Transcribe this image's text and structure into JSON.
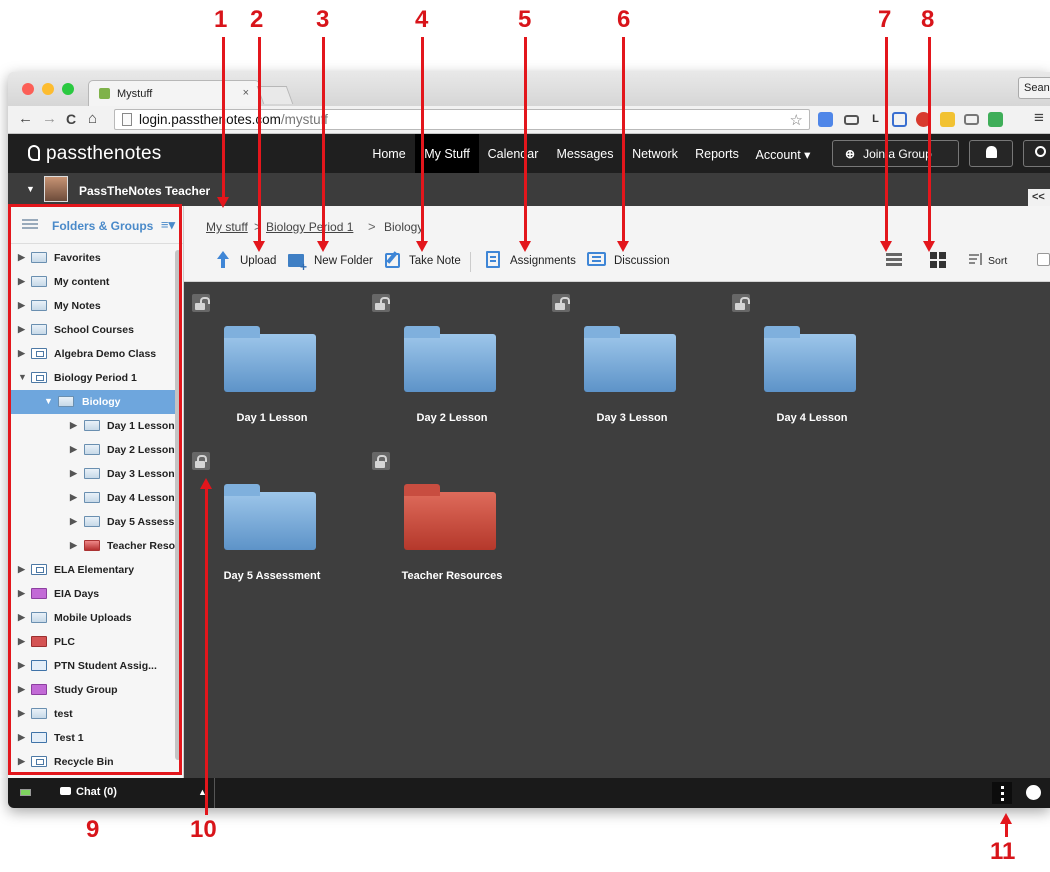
{
  "annotations": [
    "1",
    "2",
    "3",
    "4",
    "5",
    "6",
    "7",
    "8",
    "9",
    "10",
    "11"
  ],
  "browser": {
    "tab_title": "Mystuff",
    "tab_close": "×",
    "profile_label": "Sean",
    "url_host": "login.passthenotes.com",
    "url_path": "/mystuff",
    "back": "←",
    "forward": "→",
    "reload": "C",
    "home": "⌂",
    "star": "☆",
    "menu": "≡",
    "ext_l_label": "L"
  },
  "app": {
    "logo": "passthenotes",
    "nav": [
      "Home",
      "My Stuff",
      "Calendar",
      "Messages",
      "Network",
      "Reports",
      "Account ▾"
    ],
    "join_group": "Join a Group",
    "user_name": "PassTheNotes Teacher",
    "collapse": "<<"
  },
  "sidebar": {
    "title": "Folders & Groups",
    "items": [
      {
        "label": "Favorites"
      },
      {
        "label": "My content"
      },
      {
        "label": "My Notes"
      },
      {
        "label": "School Courses"
      },
      {
        "label": "Algebra Demo Class"
      },
      {
        "label": "Biology Period 1"
      },
      {
        "label": "Biology"
      },
      {
        "label": "Day 1 Lesson"
      },
      {
        "label": "Day 2 Lesson"
      },
      {
        "label": "Day 3 Lesson"
      },
      {
        "label": "Day 4 Lesson"
      },
      {
        "label": "Day 5 Assess"
      },
      {
        "label": "Teacher Reso"
      },
      {
        "label": "ELA Elementary"
      },
      {
        "label": "EIA Days"
      },
      {
        "label": "Mobile Uploads"
      },
      {
        "label": "PLC"
      },
      {
        "label": "PTN Student Assig..."
      },
      {
        "label": "Study Group"
      },
      {
        "label": "test"
      },
      {
        "label": "Test 1"
      },
      {
        "label": "Recycle Bin"
      }
    ]
  },
  "breadcrumb": [
    "My stuff",
    "Biology Period 1",
    "Biology"
  ],
  "breadcrumb_sep": ">",
  "toolbar": {
    "upload": "Upload",
    "new_folder": "New Folder",
    "take_note": "Take Note",
    "assignments": "Assignments",
    "discussion": "Discussion",
    "sort": "Sort"
  },
  "folders": [
    {
      "label": "Day 1 Lesson",
      "locked": false,
      "color": "#6fa3d6"
    },
    {
      "label": "Day 2 Lesson",
      "locked": false,
      "color": "#6fa3d6"
    },
    {
      "label": "Day 3 Lesson",
      "locked": false,
      "color": "#6fa3d6"
    },
    {
      "label": "Day 4 Lesson",
      "locked": false,
      "color": "#6fa3d6"
    },
    {
      "label": "Day 5 Assessment",
      "locked": true,
      "color": "#6fa3d6"
    },
    {
      "label": "Teacher Resources",
      "locked": true,
      "color": "#c6463a"
    }
  ],
  "footer": {
    "chat": "Chat (0)",
    "chat_caret": "▲"
  },
  "colors": {
    "annotation": "#e3161c",
    "header_bg": "#1f1f1f",
    "content_bg": "#3e3e3e",
    "sidebar_selected": "#6ea6dd",
    "accent_blue": "#4a8ac9"
  }
}
